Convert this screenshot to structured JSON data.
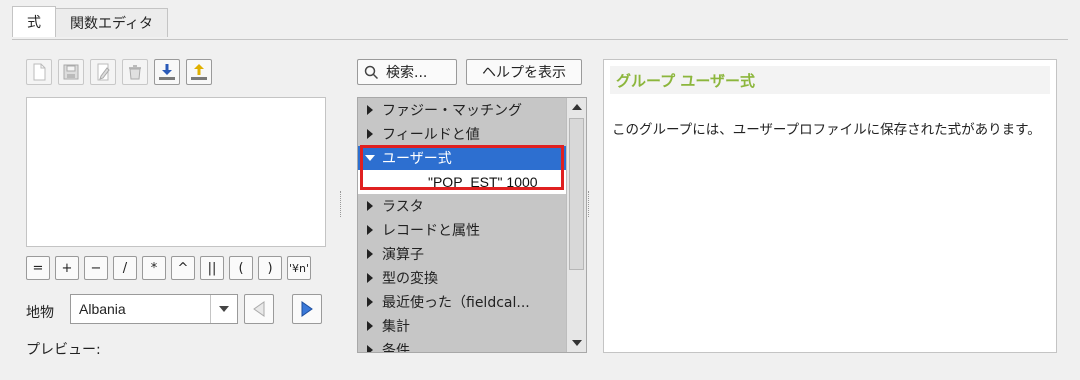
{
  "tabs": [
    {
      "label": "式",
      "active": true
    },
    {
      "label": "関数エディタ",
      "active": false
    }
  ],
  "toolbar": {
    "icons": [
      "new-file-icon",
      "save-icon",
      "edit-icon",
      "delete-icon",
      "import-icon",
      "export-icon"
    ]
  },
  "operators": [
    "=",
    "+",
    "−",
    "/",
    "*",
    "^",
    "||",
    "(",
    ")",
    "'¥n'"
  ],
  "feature": {
    "label": "地物",
    "value": "Albania"
  },
  "preview_label": "プレビュー:",
  "search": {
    "label": "検索..."
  },
  "help_button": "ヘルプを表示",
  "tree": {
    "items": [
      {
        "label": "ファジー・マッチング",
        "expanded": false
      },
      {
        "label": "フィールドと値",
        "expanded": false
      },
      {
        "label": "ユーザー式",
        "expanded": true,
        "selected": true
      },
      {
        "label": "\"POP_EST\" 1000",
        "child": true
      },
      {
        "label": "ラスタ",
        "expanded": false
      },
      {
        "label": "レコードと属性",
        "expanded": false
      },
      {
        "label": "演算子",
        "expanded": false
      },
      {
        "label": "型の変換",
        "expanded": false
      },
      {
        "label": "最近使った（fieldcal...",
        "expanded": false
      },
      {
        "label": "集計",
        "expanded": false
      },
      {
        "label": "条件",
        "expanded": false
      }
    ]
  },
  "help": {
    "title": "グループ ユーザー式",
    "body": "このグループには、ユーザープロファイルに保存された式があります。"
  },
  "colors": {
    "accent": "#2d6fd0",
    "help_title": "#8cb63c",
    "highlight": "#e02020"
  }
}
